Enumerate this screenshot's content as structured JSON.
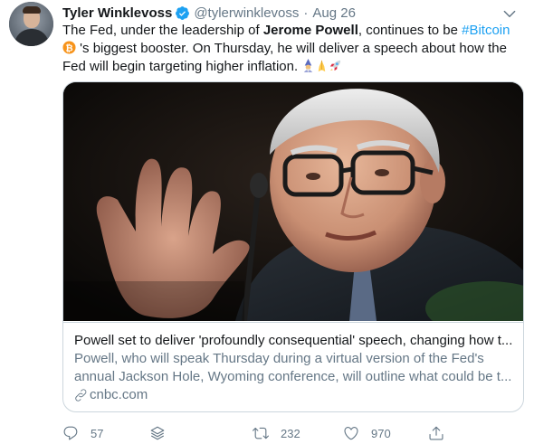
{
  "tweet": {
    "author_name": "Tyler Winklevoss",
    "handle": "@tylerwinklevoss",
    "separator": "·",
    "date": "Aug 26",
    "text": {
      "p1": "The Fed, under the leadership of ",
      "bold": "Jerome Powell",
      "p2": ", continues to be ",
      "hashtag": "#Bitcoin",
      "p3": " 's biggest booster. On Thursday, he will deliver a speech about how the Fed will begin targeting higher inflation."
    },
    "emojis": [
      "bitcoin-emoji",
      "wizard-emoji",
      "praying-hands-emoji",
      "rocket-emoji"
    ]
  },
  "card": {
    "title": "Powell set to deliver 'profoundly consequential' speech, changing how t...",
    "description_line1": "Powell, who will speak Thursday during a virtual version of the Fed's",
    "description_line2": "annual Jackson Hole, Wyoming conference, will outline what could be t...",
    "domain": "cnbc.com"
  },
  "actions": {
    "reply_count": "57",
    "retweet_count": "232",
    "like_count": "970"
  },
  "colors": {
    "link": "#1da1f2",
    "secondary_text": "#657786",
    "border": "#ccd6dd",
    "bitcoin": "#f7931a"
  }
}
